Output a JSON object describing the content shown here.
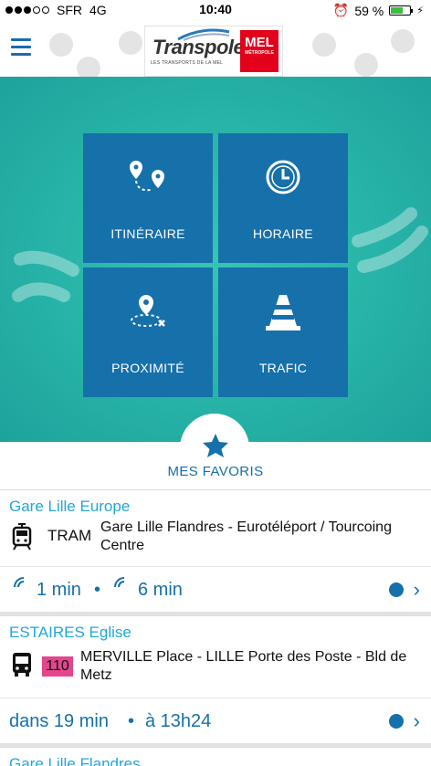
{
  "status": {
    "carrier": "SFR",
    "network": "4G",
    "time": "10:40",
    "battery": "59 %"
  },
  "header": {
    "logo": "Transpole",
    "logo_sub": "LES TRANSPORTS DE LA MEL",
    "mel": "MEL",
    "mel_sub": "MÉTROPOLE"
  },
  "tiles": [
    {
      "label": "ITINÉRAIRE",
      "icon": "route-icon"
    },
    {
      "label": "HORAIRE",
      "icon": "clock-icon"
    },
    {
      "label": "PROXIMITÉ",
      "icon": "nearby-icon"
    },
    {
      "label": "TRAFIC",
      "icon": "traffic-cone-icon"
    }
  ],
  "favorites": {
    "title": "MES FAVORIS",
    "items": [
      {
        "stop": "Gare Lille Europe",
        "mode": "TRAM",
        "dest": "Gare Lille Flandres - Eurotéléport / Tourcoing Centre",
        "t1": "1 min",
        "sep": "•",
        "t2": "6 min"
      },
      {
        "stop": "ESTAIRES Eglise",
        "line": "110",
        "dest": "MERVILLE Place - LILLE Porte des Poste - Bld de Metz",
        "t1": "dans 19 min",
        "sep": "•",
        "t2": "à 13h24"
      },
      {
        "stop": "Gare Lille Flandres"
      }
    ]
  },
  "colors": {
    "primary": "#1670aa",
    "accent": "#22a6d8",
    "teal": "#27b3a7",
    "badge": "#e3468d"
  }
}
